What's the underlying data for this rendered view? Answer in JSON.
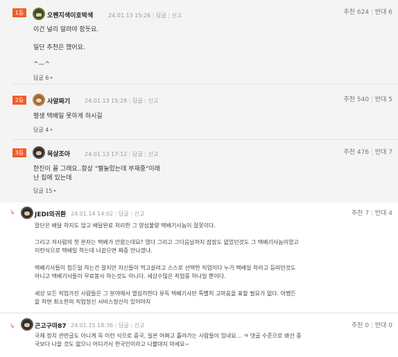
{
  "best_comments": [
    {
      "rank": "1등",
      "nickname": "오펜지색이호박색",
      "timestamp": "24.01.13 15:26",
      "reply_action": "답글",
      "report_action": "신고",
      "upvote_text": "추천 624",
      "downvote_text": "반대 6",
      "lines": [
        "이건 널리 알려야 함듯요.",
        "일단 추천은 했어요.",
        "^—^"
      ],
      "reply_count_label": "답글 6"
    },
    {
      "rank": "2등",
      "nickname": "사알짜기",
      "timestamp": "24.01.13 15:28",
      "reply_action": "답글",
      "report_action": "신고",
      "upvote_text": "추천 540",
      "downvote_text": "반대 5",
      "lines": [
        "평생 택배일 못하게 하시길"
      ],
      "reply_count_label": "답글 4"
    },
    {
      "rank": "3등",
      "nickname": "묵살조아",
      "timestamp": "24.01.13 17:12",
      "reply_action": "답글",
      "report_action": "신고",
      "upvote_text": "추천 476",
      "downvote_text": "반대 7",
      "lines": [
        "한진이 꼴 그래요..항상 \"벨눌렀는데 부재중\"이래",
        "난 집에 있는데"
      ],
      "reply_count_label": "답글 15"
    }
  ],
  "replies": [
    {
      "arrow": "↳",
      "nickname": "JEDI의귀환",
      "timestamp": "24.01.14 14:02",
      "reply_action": "답글",
      "report_action": "신고",
      "upvote_text": "추천 7",
      "downvote_text": "반대 4",
      "lines": [
        "말단은 배달 하지도 않고 배달완료 처리한 그 양심불량 택배기사놈이 잘못이다.",
        "",
        "그리고 저사람의 첫 본자는 택배가 안왔는데요? 였다 그리고 그다음날까지 잠잠도 없었던것도 그 택배기사놈이였고",
        "이런식으로 택배일 하는데 너같으면 짜증 안나겠냐.",
        "",
        "택배기사들이 힘든일 하는건 알지만 자신들이 먹고살려고 스스로 선택한 직업이다 누가 택배일 하라고 등떠민것도",
        "아니고 택배기사들이 무료봉사 하는것도 아니다. 세상수많은 직업중 하나일 뿐이다.",
        "",
        "세상 모든 직업가진 사람들은 그 분야에서 열심히한다 유독 택배기사만 특별히 고마움을 표할 필요가 없다. 어쨌든",
        "을 하면 최소한의 직업정신 서비스정신이 있어야지"
      ]
    },
    {
      "arrow": "↳",
      "nickname": "곤고구마87",
      "timestamp": "24.01.15 18:36",
      "reply_action": "답글",
      "report_action": "신고",
      "upvote_text": "추천 0",
      "downvote_text": "반대 0",
      "lines": [
        "국제 정치 관련글도 아니게 꼭 이런 식으로 중국, 일본 어쩌고 흘려가는 사람들이 있네요... ㅋ 댓글 수준으로 봐선 중",
        "국보다 나을 것도 없으니 어디가서 한국인이라고 나불대지 마세요~"
      ]
    }
  ]
}
